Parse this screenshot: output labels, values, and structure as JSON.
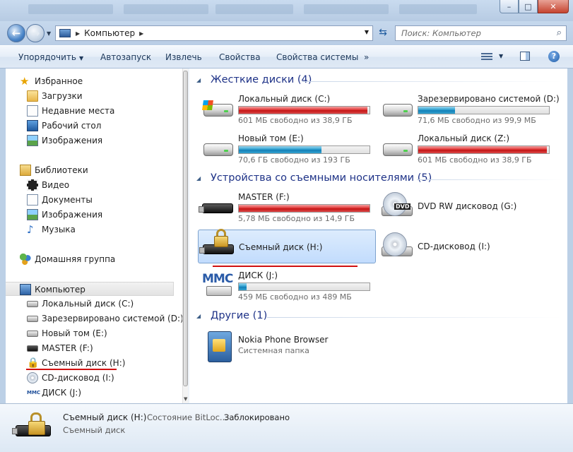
{
  "window": {
    "minimize_glyph": "–",
    "maximize_glyph": "□",
    "close_glyph": "✕"
  },
  "address": {
    "crumb": "Компьютер",
    "search_placeholder": "Поиск: Компьютер"
  },
  "toolbar": {
    "organize": "Упорядочить",
    "autorun": "Автозапуск",
    "eject": "Извлечь",
    "properties": "Свойства",
    "system_properties": "Свойства системы",
    "more": "»"
  },
  "nav": {
    "favorites": "Избранное",
    "downloads": "Загрузки",
    "recent": "Недавние места",
    "desktop": "Рабочий стол",
    "pictures_fav": "Изображения",
    "libraries": "Библиотеки",
    "video": "Видео",
    "documents": "Документы",
    "pictures": "Изображения",
    "music": "Музыка",
    "homegroup": "Домашняя группа",
    "computer": "Компьютер",
    "drive_c": "Локальный диск (C:)",
    "drive_d": "Зарезервировано системой (D:)",
    "drive_e": "Новый том (E:)",
    "drive_f": "MASTER (F:)",
    "drive_h": "Съемный диск (H:)",
    "drive_i": "CD-дисковод (I:)",
    "drive_j": "ДИСК (J:)"
  },
  "groups": {
    "hard": "Жесткие диски (4)",
    "removable": "Устройства со съемными носителями (5)",
    "other": "Другие (1)"
  },
  "drives": {
    "c": {
      "name": "Локальный диск (C:)",
      "info": "601 МБ свободно из 38,9 ГБ",
      "used_fraction": 0.985,
      "color": "red"
    },
    "d": {
      "name": "Зарезервировано системой (D:)",
      "info": "71,6 МБ свободно из 99,9 МБ",
      "used_fraction": 0.28,
      "color": "blue"
    },
    "e": {
      "name": "Новый том (E:)",
      "info": "70,6 ГБ свободно из 193 ГБ",
      "used_fraction": 0.634,
      "color": "blue"
    },
    "z": {
      "name": "Локальный диск (Z:)",
      "info": "601 МБ свободно из 38,9 ГБ",
      "used_fraction": 0.985,
      "color": "red"
    },
    "f": {
      "name": "MASTER (F:)",
      "info": "5,78 МБ свободно из 14,9 ГБ",
      "used_fraction": 0.999,
      "color": "red"
    },
    "g": {
      "name": "DVD RW дисковод (G:)",
      "badge": "DVD"
    },
    "h": {
      "name": "Съемный диск (H:)"
    },
    "i": {
      "name": "CD-дисковод (I:)"
    },
    "j": {
      "name": "ДИСК (J:)",
      "info": "459 МБ свободно из 489 МБ",
      "used_fraction": 0.061,
      "color": "blue",
      "logo": "MMC"
    },
    "nokia": {
      "name": "Nokia Phone Browser",
      "info": "Системная папка"
    }
  },
  "details": {
    "name": "Съемный диск (H:)",
    "type": "Съемный диск",
    "label": "Состояние BitLoc...",
    "value": "Заблокировано"
  },
  "annotation_color": "#d01010"
}
